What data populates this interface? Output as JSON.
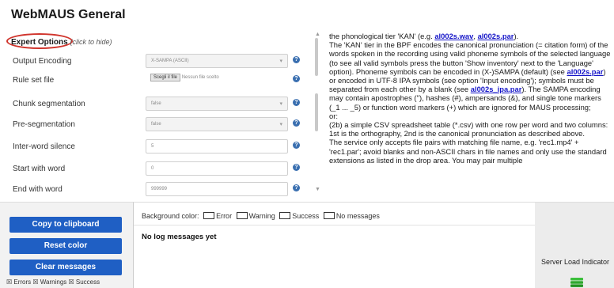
{
  "page": {
    "title": "WebMAUS General"
  },
  "expert": {
    "label": "Expert Options",
    "hint": "(click to hide)"
  },
  "fields": [
    {
      "label": "Output Encoding",
      "value": "X-SAMPA (ASCII)"
    },
    {
      "label": "Rule set file",
      "button": "Scegli il file",
      "value": "Nessun file scelto"
    },
    {
      "label": "Chunk segmentation",
      "value": "false"
    },
    {
      "label": "Pre-segmentation",
      "value": "false"
    },
    {
      "label": "Inter-word silence",
      "value": "5"
    },
    {
      "label": "Start with word",
      "value": "0"
    },
    {
      "label": "End with word",
      "value": "999999"
    }
  ],
  "help_glyph": "?",
  "info": {
    "line1": "the phonological tier 'KAN' (e.g. ",
    "link1": "al002s.wav",
    "sep1": ", ",
    "link2": "al002s.par",
    "end1": ").",
    "para1": "The 'KAN' tier in the BPF encodes the canonical pronunciation (= citation form) of the words spoken in the recording using valid phoneme symbols of the selected language (to see all valid symbols press the button 'Show inventory' next to the 'Language' option). Phoneme symbols can be encoded in (X-)SAMPA (default) (see ",
    "link3": "al002s.par",
    "para1b": ") or encoded in UTF-8 IPA symbols (see option 'Input encoding'); symbols must be separated from each other by a blank (see ",
    "link4": "al002s_ipa.par",
    "para1c": "). The SAMPA encoding may contain apostrophes (''), hashes (#), ampersands (&), and single tone markers (_1 ... _5) or function word markers (+) which are ignored for MAUS processing;",
    "or": "or:",
    "para2": "(2b) a simple CSV spreadsheet table (*.csv) with one row per word and two columns: 1st is the orthography, 2nd is the canonical pronunciation as described above.",
    "para3": "The service only accepts file pairs with matching file name, e.g. 'rec1.mp4' + 'rec1.par'; avoid blanks and non-ASCII chars in file names and only use the standard extensions as listed in the drop area. You may pair multiple"
  },
  "buttons": {
    "copy": "Copy to clipboard",
    "reset": "Reset color",
    "clear": "Clear messages"
  },
  "filters": "☒ Errors ☒ Warnings ☒ Success",
  "log": {
    "bg_label": "Background color:",
    "error": "Error",
    "warning": "Warning",
    "success": "Success",
    "none": "No messages",
    "empty": "No log messages yet"
  },
  "server": {
    "label": "Server Load Indicator"
  },
  "colors": {
    "accent": "#1f5fc4",
    "highlight": "#d0342c",
    "link": "#1515c8"
  }
}
